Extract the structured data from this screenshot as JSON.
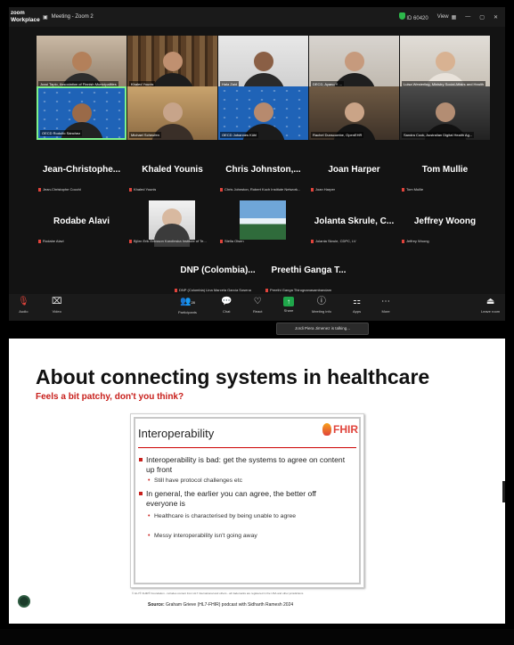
{
  "app": {
    "logo_line1": "zoom",
    "logo_line2": "Workplace",
    "meeting_title": "Meeting - Zoom 2",
    "meeting_id": "ID 60420",
    "view_label": "View"
  },
  "video_tiles": [
    {
      "name": "Jussi Tapio, Association of Finnish Municipalities"
    },
    {
      "name": "Khaled Younis"
    },
    {
      "name": "Hala Zaid"
    },
    {
      "name": "DECD, Ayano Y. ..."
    },
    {
      "name": "Luisa Westerling, Ministry Social Affairs and Health"
    },
    {
      "name": "OECD Rodolfo Sánchez"
    },
    {
      "name": "Michael Scheufen"
    },
    {
      "name": "OECD Johannes Kühl"
    },
    {
      "name": "Rachel Dunscombe, OpenEHR"
    },
    {
      "name": "Sandra Cook, Australian Digital Health Ag..."
    }
  ],
  "name_tiles": [
    {
      "name": "Jean-Christophe...",
      "sub": "Jean-Christophe Cocchi"
    },
    {
      "name": "Khaled Younis",
      "sub": "Khaled Younis"
    },
    {
      "name": "Chris Johnston,...",
      "sub": "Chris Johnston, Robert Koch Institute Network..."
    },
    {
      "name": "Joan Harper",
      "sub": "Joan Harper"
    },
    {
      "name": "Tom Mullie",
      "sub": "Tom Mullie"
    },
    {
      "name": "Rodabe Alavi",
      "sub": "Rodabe Alavi"
    },
    {
      "name": "",
      "sub": "Björn Erik Eriksson Karolinska Institute of Te..."
    },
    {
      "name": "",
      "sub": "Stella Olsen"
    },
    {
      "name": "Jolanta Skrule, C...",
      "sub": "Jolanta Skrule, CDPC, LV"
    },
    {
      "name": "Jeffrey Woong",
      "sub": "Jeffrey Woong"
    },
    {
      "name": "DNP (Colombia)...",
      "sub": "DNP (Colombia) Lina Marcela García Sosena"
    },
    {
      "name": "Preethi Ganga T...",
      "sub": "Preethi Ganga Thirugnanasambandam"
    }
  ],
  "toolbar": {
    "audio": "Audio",
    "video": "Video",
    "participants": "Participants",
    "participants_count": "28",
    "chat": "Chat",
    "react": "React",
    "share": "Share",
    "meeting_info": "Meeting info",
    "apps": "Apps",
    "more": "More",
    "leave": "Leave room"
  },
  "talking_tooltip": "Jordi Piera Jimenez is talking...",
  "slide": {
    "title": "About connecting systems in healthcare",
    "subtitle": "Feels a bit patchy, don't you think?",
    "inner_title": "Interoperability",
    "fhir_label": "FHIR",
    "bullets": [
      {
        "text": "Interoperability is bad: get the systems to agree on content up front",
        "subs": [
          "Still have protocol challenges etc"
        ]
      },
      {
        "text": "In general, the earlier you can agree, the better off everyone is",
        "subs": [
          "Healthcare is characterised by being unable to agree",
          "Messy interoperability isn't going away"
        ]
      }
    ],
    "citation": "© HL7® FHIR® Foundation - includes content from HL7 International and others - all trademarks are registered in the USA and other jurisdictions",
    "source_label": "Source:",
    "source_text": "Graham Grieve (HL7-FHIR) podcast with Sidharth Ramesh 2024"
  }
}
